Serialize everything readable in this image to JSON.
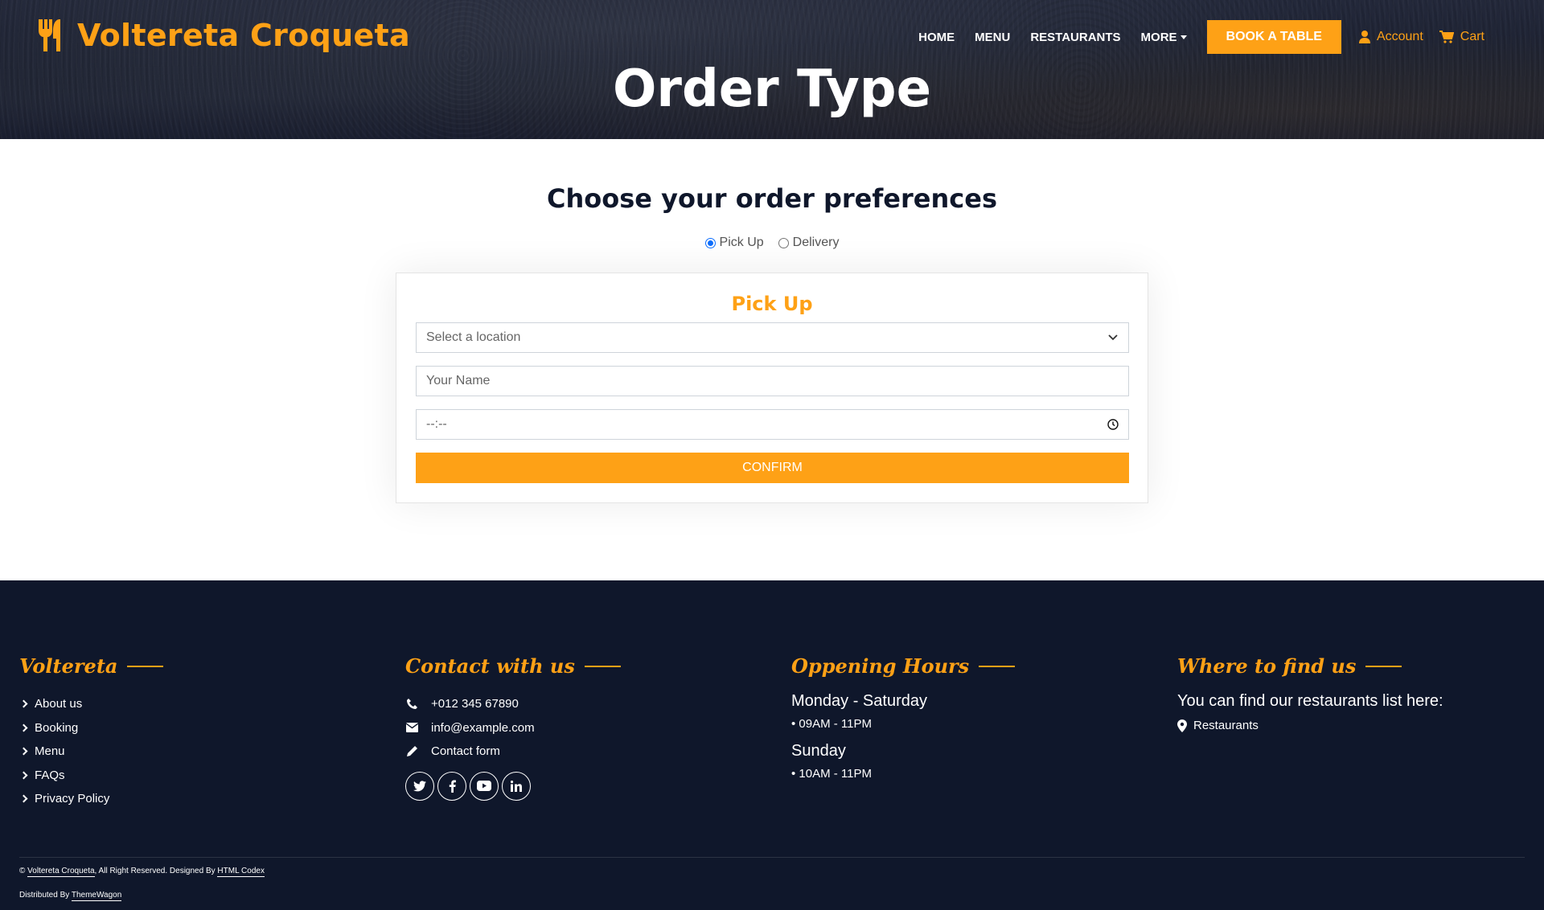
{
  "brand": {
    "name": "Voltereta Croqueta",
    "icon": "utensils-icon",
    "color": "#fea116"
  },
  "nav": {
    "links": [
      "HOME",
      "MENU",
      "RESTAURANTS"
    ],
    "more_label": "MORE",
    "book_label": "BOOK A TABLE",
    "account_label": "Account",
    "cart_label": "Cart"
  },
  "hero": {
    "title": "Order Type"
  },
  "order": {
    "heading": "Choose your order preferences",
    "options": [
      {
        "label": "Pick Up",
        "checked": true
      },
      {
        "label": "Delivery",
        "checked": false
      }
    ],
    "card_title": "Pick Up",
    "location_placeholder": "Select a location",
    "name_placeholder": "Your Name",
    "time_value": "--:--",
    "confirm_label": "CONFIRM"
  },
  "footer": {
    "col1": {
      "heading": "Voltereta",
      "links": [
        "About us",
        "Booking",
        "Menu",
        "FAQs",
        "Privacy Policy"
      ]
    },
    "col2": {
      "heading": "Contact with us",
      "phone": "+012 345 67890",
      "email": "info@example.com",
      "contact": "Contact form",
      "socials": [
        "twitter-icon",
        "facebook-icon",
        "youtube-icon",
        "linkedin-icon"
      ]
    },
    "col3": {
      "heading": "Oppening Hours",
      "day1": "Monday - Saturday",
      "time1": "• 09AM - 11PM",
      "day2": "Sunday",
      "time2": "• 10AM - 11PM"
    },
    "col4": {
      "heading": "Where to find us",
      "desc": "You can find our restaurants list here:",
      "link": "Restaurants"
    },
    "copyright": {
      "prefix": "©",
      "site": "Voltereta Croqueta",
      "middle": ", All Right Reserved. Designed By",
      "designer": "HTML Codex"
    },
    "distributed": {
      "prefix": "Distributed By",
      "name": "ThemeWagon"
    }
  },
  "colors": {
    "accent": "#fea116",
    "dark": "#0f172b"
  }
}
